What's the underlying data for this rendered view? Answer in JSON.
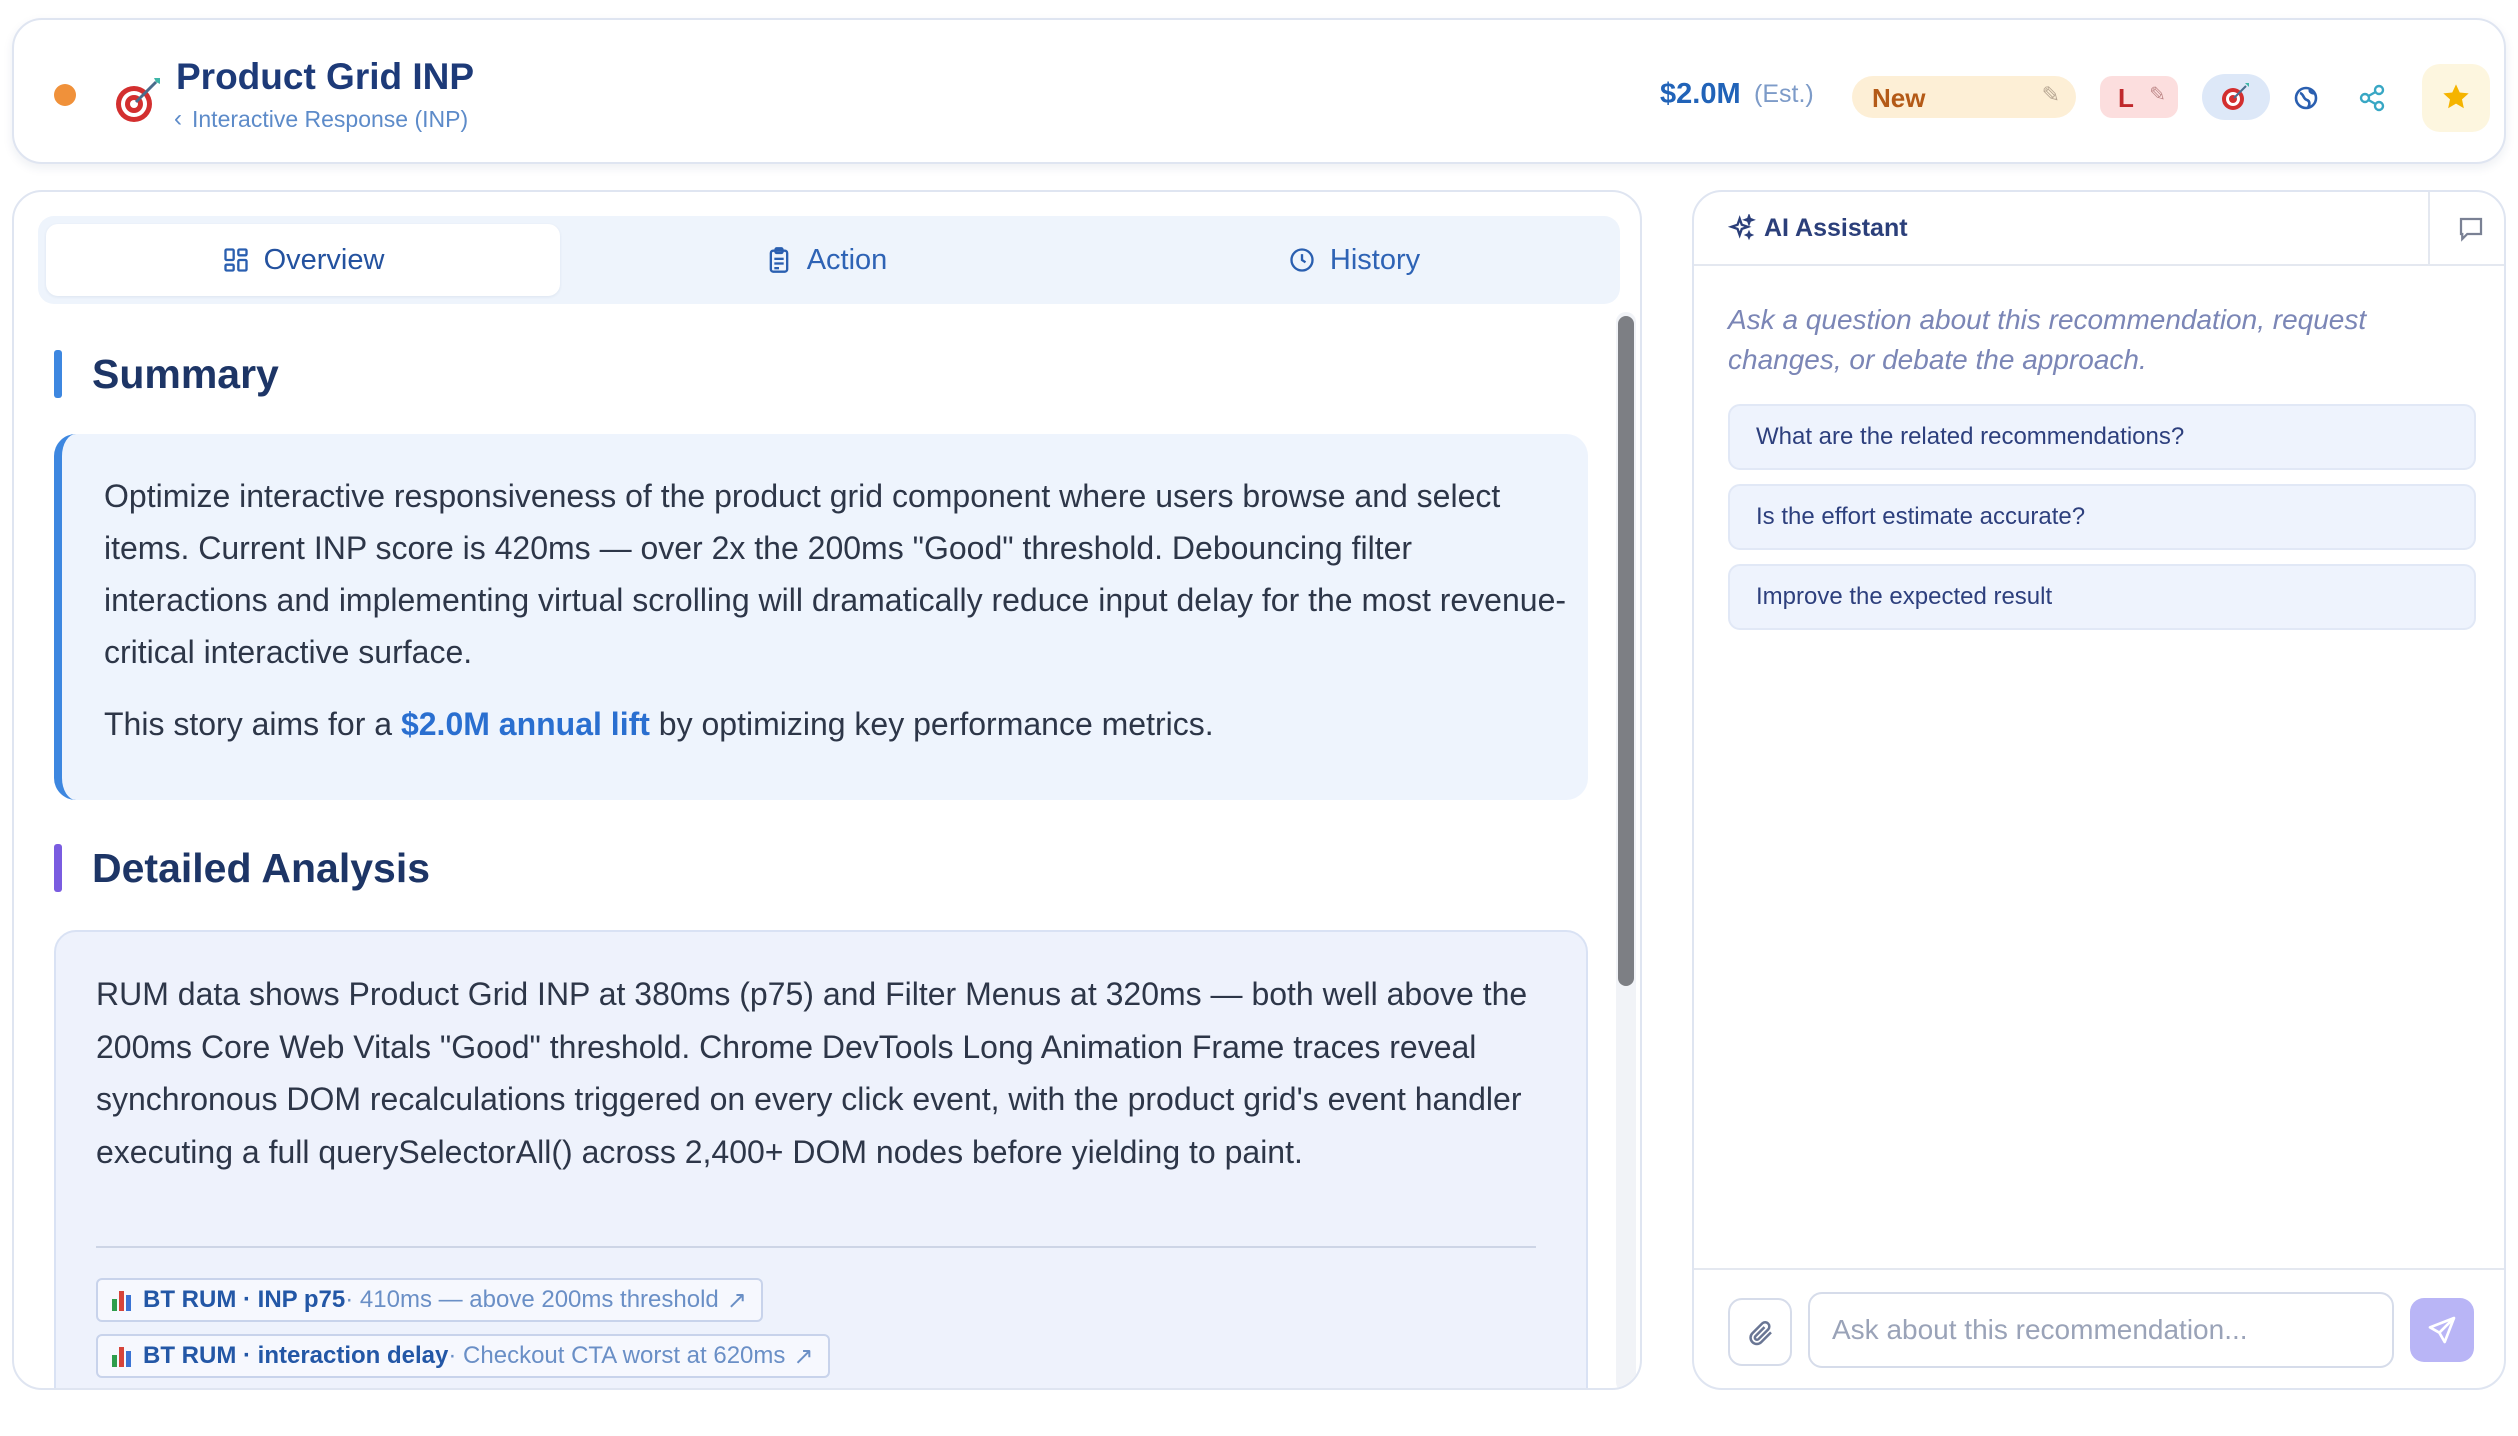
{
  "header": {
    "title": "Product Grid INP",
    "breadcrumb": "Interactive Response (INP)",
    "value": "$2.0M",
    "value_note": "(Est.)",
    "status_badge": "New",
    "effort_badge": "L",
    "status_dot_color": "#f0913a",
    "icons": [
      "target-icon",
      "globe-icon",
      "share-icon",
      "star-icon"
    ]
  },
  "tabs": [
    {
      "label": "Overview",
      "icon": "grid-icon",
      "active": true
    },
    {
      "label": "Action",
      "icon": "clipboard-icon",
      "active": false
    },
    {
      "label": "History",
      "icon": "clock-icon",
      "active": false
    }
  ],
  "summary": {
    "heading": "Summary",
    "paragraph": "Optimize interactive responsiveness of the product grid component where users browse and select items. Current INP score is 420ms — over 2x the 200ms \"Good\" threshold. Debouncing filter interactions and implementing virtual scrolling will dramatically reduce input delay for the most revenue-critical interactive surface.",
    "lift_prefix": "This story aims for a ",
    "lift_value": "$2.0M annual lift",
    "lift_suffix": " by optimizing key performance metrics."
  },
  "analysis": {
    "heading": "Detailed Analysis",
    "paragraph": "RUM data shows Product Grid INP at 380ms (p75) and Filter Menus at 320ms — both well above the 200ms Core Web Vitals \"Good\" threshold. Chrome DevTools Long Animation Frame traces reveal synchronous DOM recalculations triggered on every click event, with the product grid's event handler executing a full querySelectorAll() across 2,400+ DOM nodes before yielding to paint.",
    "sources": [
      {
        "source": "BT RUM · INP p75",
        "detail": " · 410ms — above 200ms threshold",
        "arrow": "↗"
      },
      {
        "source": "BT RUM · interaction delay",
        "detail": " · Checkout CTA worst at 620ms",
        "arrow": "↗"
      }
    ]
  },
  "assistant": {
    "title": "AI Assistant",
    "intro": "Ask a question about this recommendation, request changes, or debate the approach.",
    "suggestions": [
      "What are the related recommendations?",
      "Is the effort estimate accurate?",
      "Improve the expected result"
    ],
    "input_placeholder": "Ask about this recommendation..."
  },
  "colors": {
    "accent_blue": "#2a6fd0",
    "summary_bar": "#3d87e0",
    "analysis_bar": "#7a5ce0",
    "send_button": "#b9b5f6"
  }
}
